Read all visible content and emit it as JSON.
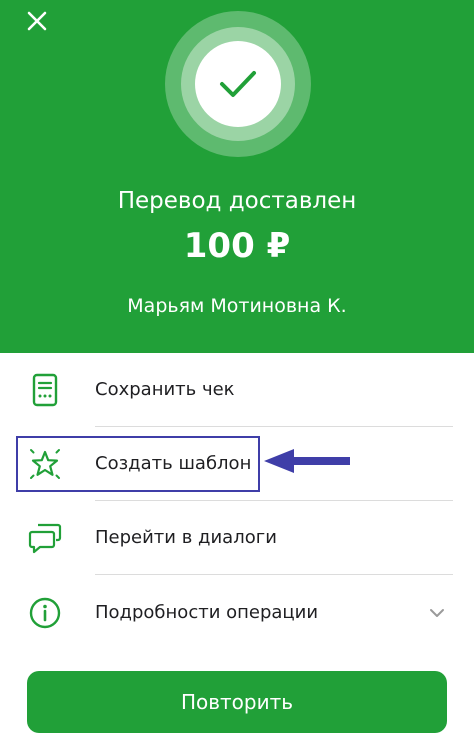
{
  "header": {
    "status_title": "Перевод доставлен",
    "amount": "100 ₽",
    "recipient": "Марьям Мотиновна К."
  },
  "actions": [
    {
      "label": "Сохранить чек",
      "icon": "receipt-icon"
    },
    {
      "label": "Создать шаблон",
      "icon": "star-icon"
    },
    {
      "label": "Перейти в диалоги",
      "icon": "chat-icon"
    },
    {
      "label": "Подробности операции",
      "icon": "info-icon"
    }
  ],
  "repeat_button": {
    "label": "Повторить"
  },
  "colors": {
    "brand_green": "#21a038",
    "highlight_blue": "#3f3ea8",
    "text_dark": "#1f1f22"
  }
}
